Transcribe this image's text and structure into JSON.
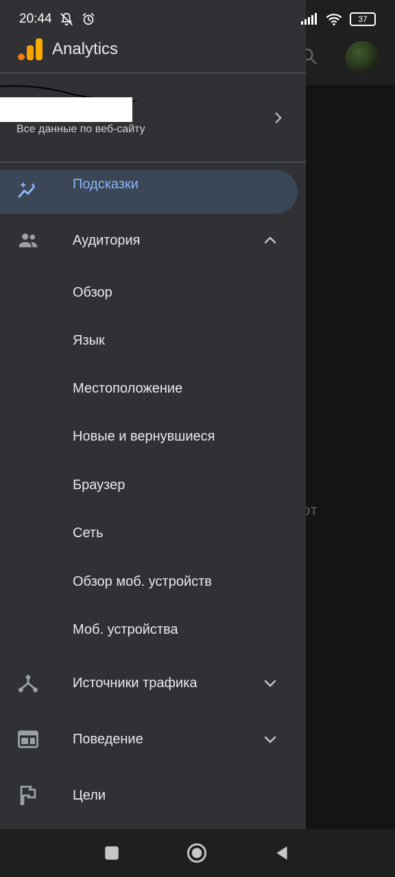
{
  "status_bar": {
    "time": "20:44",
    "battery": "37"
  },
  "app": {
    "title": "Analytics",
    "background_text": "от"
  },
  "account": {
    "subtitle": "Все данные по веб-сайту"
  },
  "nav": {
    "insights": {
      "label": "Подсказки",
      "icon": "insights-sparkle-icon"
    },
    "audience": {
      "label": "Аудитория",
      "icon": "people-icon",
      "expanded": true,
      "items": [
        {
          "label": "Обзор"
        },
        {
          "label": "Язык"
        },
        {
          "label": "Местоположение"
        },
        {
          "label": "Новые и вернувшиеся"
        },
        {
          "label": "Браузер"
        },
        {
          "label": "Сеть"
        },
        {
          "label": "Обзор моб. устройств"
        },
        {
          "label": "Моб. устройства"
        }
      ]
    },
    "traffic": {
      "label": "Источники трафика",
      "icon": "traffic-merge-icon"
    },
    "behavior": {
      "label": "Поведение",
      "icon": "web-layout-icon"
    },
    "goals": {
      "label": "Цели",
      "icon": "flag-icon"
    }
  },
  "colors": {
    "drawer_bg": "#303134",
    "active_bg": "#3b4656",
    "active_text": "#8ab4f8",
    "logo_orange": "#f9ab00"
  }
}
